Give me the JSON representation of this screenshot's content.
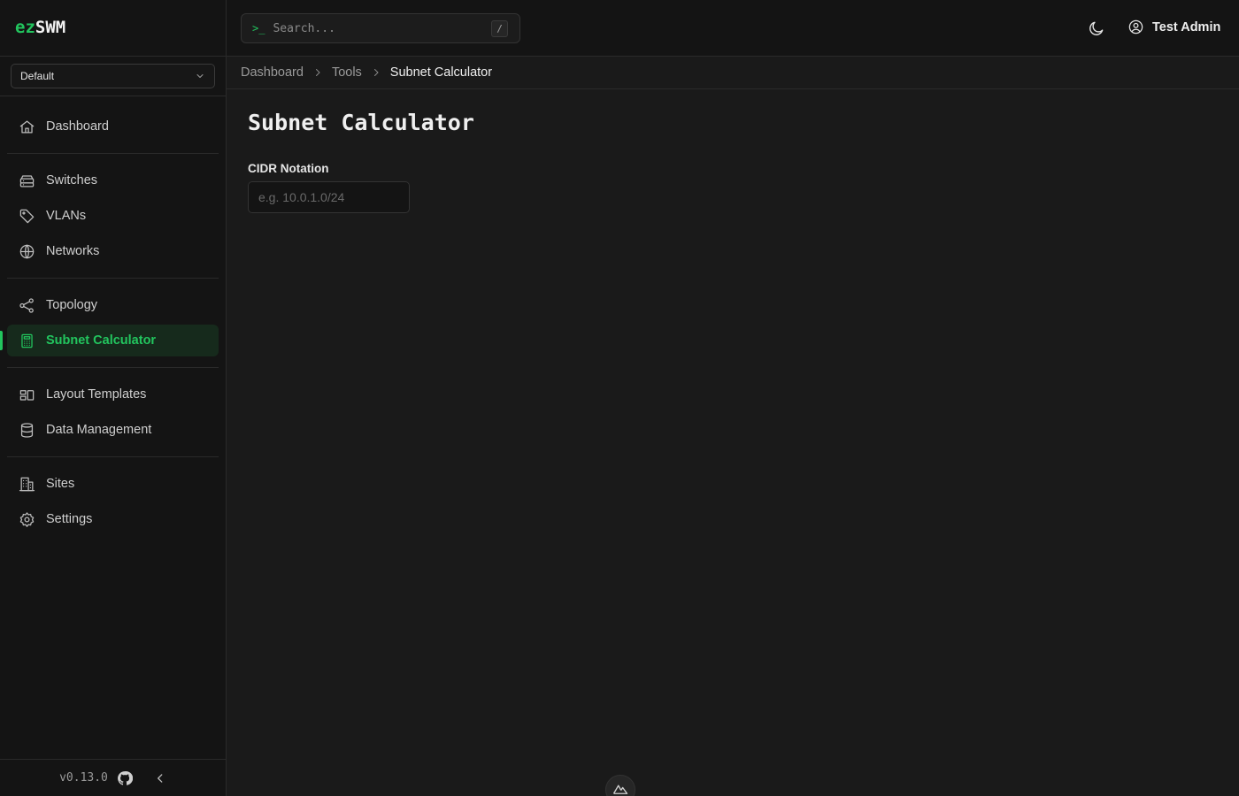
{
  "app": {
    "logo_prefix": "ez",
    "logo_suffix": "SWM",
    "accent_color": "#22c55e"
  },
  "site_selector": {
    "value": "Default"
  },
  "sidebar": {
    "items": [
      {
        "label": "Dashboard",
        "icon": "home-icon"
      },
      {
        "label": "Switches",
        "icon": "server-icon"
      },
      {
        "label": "VLANs",
        "icon": "tag-icon"
      },
      {
        "label": "Networks",
        "icon": "globe-icon"
      },
      {
        "label": "Topology",
        "icon": "share-icon"
      },
      {
        "label": "Subnet Calculator",
        "icon": "calculator-icon",
        "active": true
      },
      {
        "label": "Layout Templates",
        "icon": "layout-icon"
      },
      {
        "label": "Data Management",
        "icon": "database-icon"
      },
      {
        "label": "Sites",
        "icon": "building-icon"
      },
      {
        "label": "Settings",
        "icon": "gear-icon"
      }
    ],
    "version": "v0.13.0"
  },
  "topbar": {
    "search_prompt": ">_",
    "search_placeholder": "Search...",
    "search_shortcut": "/",
    "user_name": "Test Admin"
  },
  "breadcrumb": [
    "Dashboard",
    "Tools",
    "Subnet Calculator"
  ],
  "main": {
    "title": "Subnet Calculator",
    "cidr_label": "CIDR Notation",
    "cidr_placeholder": "e.g. 10.0.1.0/24",
    "cidr_value": ""
  }
}
